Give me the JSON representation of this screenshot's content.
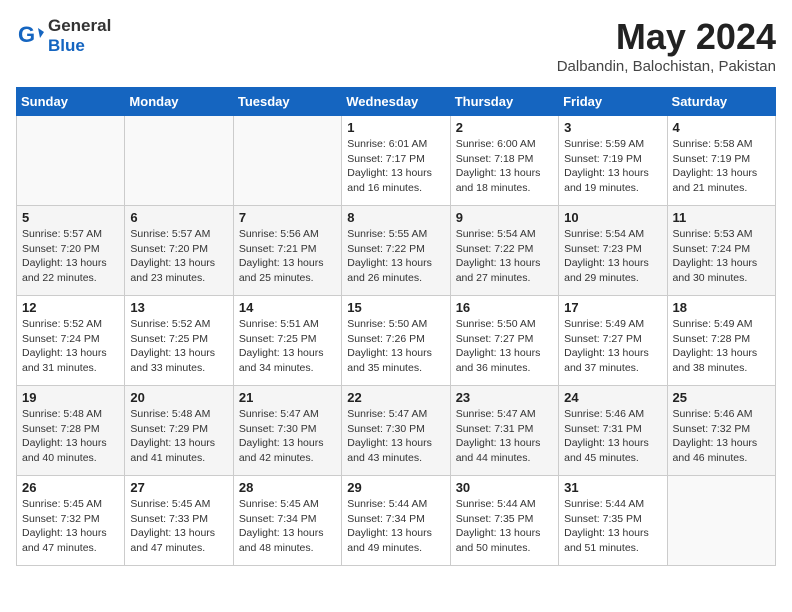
{
  "header": {
    "logo_general": "General",
    "logo_blue": "Blue",
    "month_year": "May 2024",
    "location": "Dalbandin, Balochistan, Pakistan"
  },
  "days_of_week": [
    "Sunday",
    "Monday",
    "Tuesday",
    "Wednesday",
    "Thursday",
    "Friday",
    "Saturday"
  ],
  "weeks": [
    [
      {
        "day": "",
        "info": ""
      },
      {
        "day": "",
        "info": ""
      },
      {
        "day": "",
        "info": ""
      },
      {
        "day": "1",
        "info": "Sunrise: 6:01 AM\nSunset: 7:17 PM\nDaylight: 13 hours\nand 16 minutes."
      },
      {
        "day": "2",
        "info": "Sunrise: 6:00 AM\nSunset: 7:18 PM\nDaylight: 13 hours\nand 18 minutes."
      },
      {
        "day": "3",
        "info": "Sunrise: 5:59 AM\nSunset: 7:19 PM\nDaylight: 13 hours\nand 19 minutes."
      },
      {
        "day": "4",
        "info": "Sunrise: 5:58 AM\nSunset: 7:19 PM\nDaylight: 13 hours\nand 21 minutes."
      }
    ],
    [
      {
        "day": "5",
        "info": "Sunrise: 5:57 AM\nSunset: 7:20 PM\nDaylight: 13 hours\nand 22 minutes."
      },
      {
        "day": "6",
        "info": "Sunrise: 5:57 AM\nSunset: 7:20 PM\nDaylight: 13 hours\nand 23 minutes."
      },
      {
        "day": "7",
        "info": "Sunrise: 5:56 AM\nSunset: 7:21 PM\nDaylight: 13 hours\nand 25 minutes."
      },
      {
        "day": "8",
        "info": "Sunrise: 5:55 AM\nSunset: 7:22 PM\nDaylight: 13 hours\nand 26 minutes."
      },
      {
        "day": "9",
        "info": "Sunrise: 5:54 AM\nSunset: 7:22 PM\nDaylight: 13 hours\nand 27 minutes."
      },
      {
        "day": "10",
        "info": "Sunrise: 5:54 AM\nSunset: 7:23 PM\nDaylight: 13 hours\nand 29 minutes."
      },
      {
        "day": "11",
        "info": "Sunrise: 5:53 AM\nSunset: 7:24 PM\nDaylight: 13 hours\nand 30 minutes."
      }
    ],
    [
      {
        "day": "12",
        "info": "Sunrise: 5:52 AM\nSunset: 7:24 PM\nDaylight: 13 hours\nand 31 minutes."
      },
      {
        "day": "13",
        "info": "Sunrise: 5:52 AM\nSunset: 7:25 PM\nDaylight: 13 hours\nand 33 minutes."
      },
      {
        "day": "14",
        "info": "Sunrise: 5:51 AM\nSunset: 7:25 PM\nDaylight: 13 hours\nand 34 minutes."
      },
      {
        "day": "15",
        "info": "Sunrise: 5:50 AM\nSunset: 7:26 PM\nDaylight: 13 hours\nand 35 minutes."
      },
      {
        "day": "16",
        "info": "Sunrise: 5:50 AM\nSunset: 7:27 PM\nDaylight: 13 hours\nand 36 minutes."
      },
      {
        "day": "17",
        "info": "Sunrise: 5:49 AM\nSunset: 7:27 PM\nDaylight: 13 hours\nand 37 minutes."
      },
      {
        "day": "18",
        "info": "Sunrise: 5:49 AM\nSunset: 7:28 PM\nDaylight: 13 hours\nand 38 minutes."
      }
    ],
    [
      {
        "day": "19",
        "info": "Sunrise: 5:48 AM\nSunset: 7:28 PM\nDaylight: 13 hours\nand 40 minutes."
      },
      {
        "day": "20",
        "info": "Sunrise: 5:48 AM\nSunset: 7:29 PM\nDaylight: 13 hours\nand 41 minutes."
      },
      {
        "day": "21",
        "info": "Sunrise: 5:47 AM\nSunset: 7:30 PM\nDaylight: 13 hours\nand 42 minutes."
      },
      {
        "day": "22",
        "info": "Sunrise: 5:47 AM\nSunset: 7:30 PM\nDaylight: 13 hours\nand 43 minutes."
      },
      {
        "day": "23",
        "info": "Sunrise: 5:47 AM\nSunset: 7:31 PM\nDaylight: 13 hours\nand 44 minutes."
      },
      {
        "day": "24",
        "info": "Sunrise: 5:46 AM\nSunset: 7:31 PM\nDaylight: 13 hours\nand 45 minutes."
      },
      {
        "day": "25",
        "info": "Sunrise: 5:46 AM\nSunset: 7:32 PM\nDaylight: 13 hours\nand 46 minutes."
      }
    ],
    [
      {
        "day": "26",
        "info": "Sunrise: 5:45 AM\nSunset: 7:32 PM\nDaylight: 13 hours\nand 47 minutes."
      },
      {
        "day": "27",
        "info": "Sunrise: 5:45 AM\nSunset: 7:33 PM\nDaylight: 13 hours\nand 47 minutes."
      },
      {
        "day": "28",
        "info": "Sunrise: 5:45 AM\nSunset: 7:34 PM\nDaylight: 13 hours\nand 48 minutes."
      },
      {
        "day": "29",
        "info": "Sunrise: 5:44 AM\nSunset: 7:34 PM\nDaylight: 13 hours\nand 49 minutes."
      },
      {
        "day": "30",
        "info": "Sunrise: 5:44 AM\nSunset: 7:35 PM\nDaylight: 13 hours\nand 50 minutes."
      },
      {
        "day": "31",
        "info": "Sunrise: 5:44 AM\nSunset: 7:35 PM\nDaylight: 13 hours\nand 51 minutes."
      },
      {
        "day": "",
        "info": ""
      }
    ]
  ]
}
